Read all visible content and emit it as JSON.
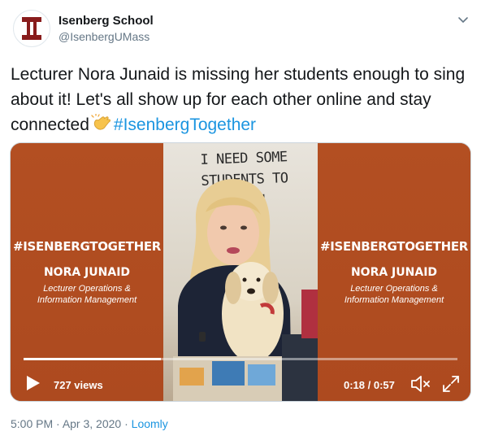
{
  "author": {
    "name": "Isenberg School",
    "handle": "@IsenbergUMass",
    "avatar_letter": "I",
    "avatar_color": "#881c1c"
  },
  "tweet": {
    "text_part1": "Lecturer Nora Junaid is missing her students enough to sing about it! Let's all show up for each other online and stay connected",
    "emoji": "clapping-hands",
    "hashtag": "#IsenbergTogether"
  },
  "video": {
    "sign_line1": "I NEED SOME",
    "sign_line2": "STUDENTS TO TEACH",
    "panel_hashtag": "#ISENBERGTOGETHER",
    "panel_name": "NORA JUNAID",
    "panel_role_line1": "Lecturer Operations &",
    "panel_role_line2": "Information Management",
    "views": "727 views",
    "current_time": "0:18",
    "duration": "0:57",
    "progress_fraction": 0.3158,
    "panel_color": "#b34f22"
  },
  "meta": {
    "time": "5:00 PM",
    "separator": " · ",
    "date": "Apr 3, 2020",
    "source": "Loomly"
  }
}
